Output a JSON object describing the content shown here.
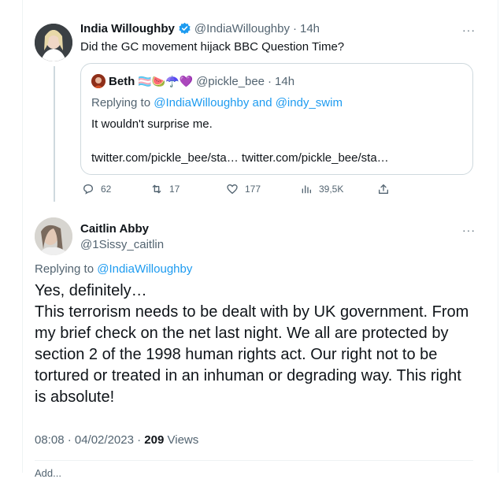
{
  "parent_tweet": {
    "author_name": "India Willoughby",
    "author_handle": "@IndiaWilloughby",
    "separator": "·",
    "time": "14h",
    "text": "Did the GC movement hijack BBC Question Time?",
    "more_label": "···",
    "quoted": {
      "author_name": "Beth",
      "emoji": "🏳️‍⚧️🍉☂️💜",
      "author_handle": "@pickle_bee",
      "time": "14h",
      "replying_prefix": "Replying to",
      "replying_users": "@IndiaWilloughby and @indy_swim",
      "text": "It wouldn't surprise me.",
      "links": "twitter.com/pickle_bee/sta… twitter.com/pickle_bee/sta…"
    },
    "actions": {
      "replies": "62",
      "retweets": "17",
      "likes": "177",
      "views": "39,5K"
    }
  },
  "main_tweet": {
    "author_name": "Caitlin Abby",
    "author_handle": "@1Sissy_caitlin",
    "more_label": "···",
    "replying_prefix": "Replying to",
    "replying_user": "@IndiaWilloughby",
    "text": "Yes, definitely…\nThis terrorism needs to be dealt with by UK government. From my brief check on the net last night. We all are protected by section 2 of the 1998 human rights act. Our right not to be tortured or treated in an inhuman or degrading way. This right is absolute!",
    "timestamp": "08:08 · 04/02/2023",
    "separator": "·",
    "views_count": "209",
    "views_label": "Views",
    "cutoff_text": "Add..."
  },
  "colors": {
    "verified": "#1d9bf0",
    "link": "#1d9bf0",
    "muted": "#536471",
    "border": "#cfd9de"
  }
}
